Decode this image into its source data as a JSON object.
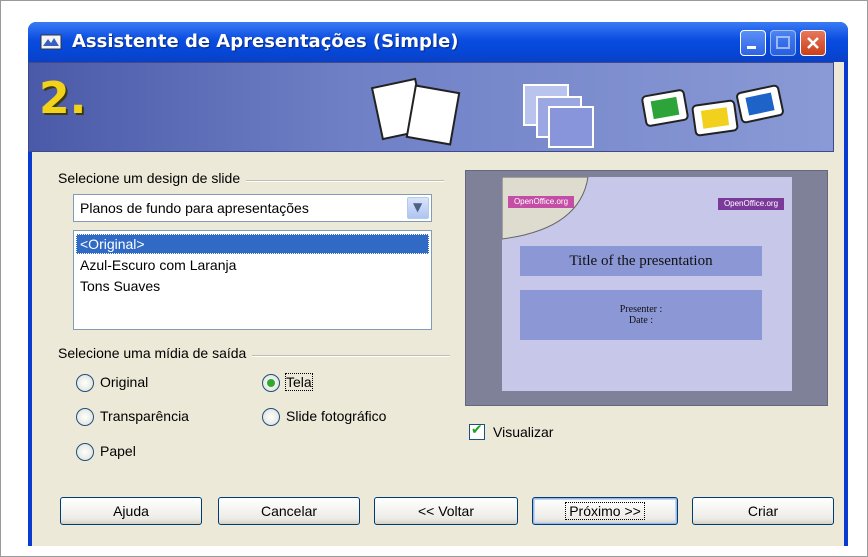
{
  "window": {
    "title": "Assistente de Apresentações (Simple)"
  },
  "banner": {
    "step_number": "2."
  },
  "design": {
    "group_label": "Selecione um design de slide",
    "dropdown_selected": "Planos de fundo para apresentações",
    "list_items": [
      "<Original>",
      "Azul-Escuro com Laranja",
      "Tons Suaves"
    ],
    "selected_index": 0
  },
  "media": {
    "group_label": "Selecione uma mídia de saída",
    "options": {
      "original": "Original",
      "tela": "Tela",
      "transparencia": "Transparência",
      "slide": "Slide fotográfico",
      "papel": "Papel"
    },
    "selected": "Tela"
  },
  "preview": {
    "slide_title": "Title of the presentation",
    "presenter": "Presenter :",
    "date": "Date :",
    "logo_left": "OpenOffice.org",
    "logo_right": "OpenOffice.org",
    "checkbox_label": "Visualizar",
    "checkbox_checked": true
  },
  "buttons": {
    "help": "Ajuda",
    "cancel": "Cancelar",
    "back": "<< Voltar",
    "next": "Próximo >>",
    "create": "Criar"
  },
  "colors": {
    "titlebar": "#0a4ce0",
    "selection": "#316ac5",
    "radio_dot": "#2fa92f"
  }
}
